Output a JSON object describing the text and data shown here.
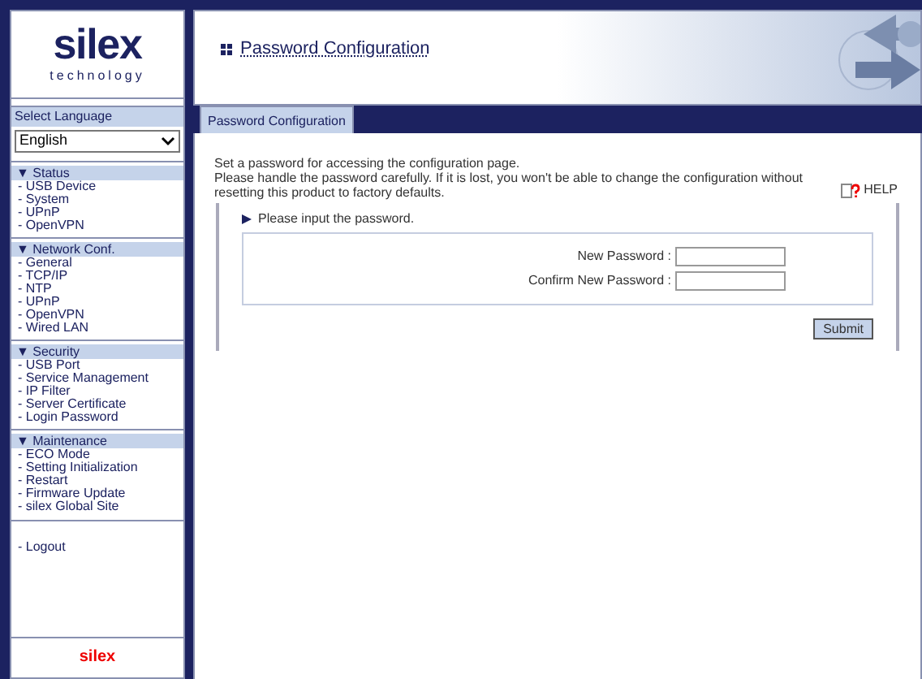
{
  "logo": {
    "name": "silex",
    "tagline": "technology"
  },
  "language": {
    "label": "Select Language",
    "value": "English"
  },
  "sidebar": [
    {
      "title": "▼ Status",
      "items": [
        "- USB Device",
        "- System",
        "- UPnP",
        "- OpenVPN"
      ]
    },
    {
      "title": "▼ Network Conf.",
      "items": [
        "- General",
        "- TCP/IP",
        "- NTP",
        "- UPnP",
        "- OpenVPN",
        "- Wired LAN"
      ]
    },
    {
      "title": "▼ Security",
      "items": [
        "- USB Port",
        "- Service Management",
        "- IP Filter",
        "- Server Certificate",
        "- Login Password"
      ]
    },
    {
      "title": "▼ Maintenance",
      "items": [
        "- ECO Mode",
        "- Setting Initialization",
        "- Restart",
        "- Firmware Update",
        "- silex Global Site"
      ]
    }
  ],
  "logout": "- Logout",
  "footer_brand": "silex",
  "page_title": "Password Configuration",
  "tabs": [
    {
      "label": "Password Configuration",
      "selected": true
    }
  ],
  "intro": [
    "Set a password for accessing the configuration page.",
    "Please handle the password carefully. If it is lost, you won't be able to change the configuration without resetting this product to factory defaults."
  ],
  "help": "HELP",
  "section_title": "Please input the password.",
  "fields": [
    {
      "label": "New Password :"
    },
    {
      "label": "Confirm New Password :"
    }
  ],
  "submit": "Submit"
}
